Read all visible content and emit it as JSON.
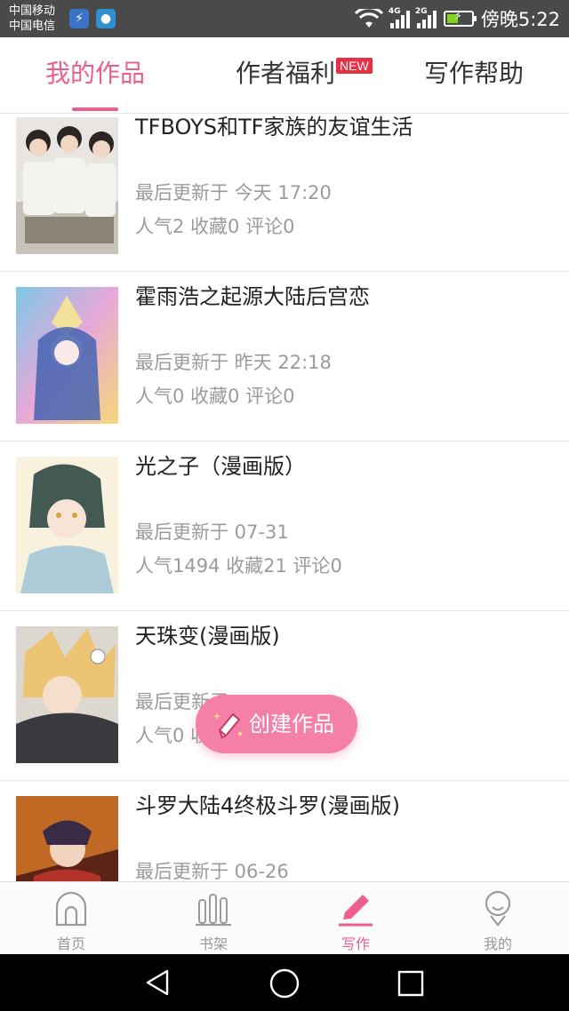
{
  "status_bar": {
    "carrier_1": "中国移动",
    "carrier_2": "中国电信",
    "net_1": "4G",
    "net_2": "2G",
    "time": "傍晚5:22"
  },
  "tabs": [
    {
      "label": "我的作品",
      "active": true
    },
    {
      "label": "作者福利",
      "active": false,
      "badge": "NEW"
    },
    {
      "label": "写作帮助",
      "active": false
    }
  ],
  "works": [
    {
      "title": "TFBOYS和TF家族的友谊生活",
      "updated": "最后更新于 今天 17:20",
      "stats": "人气2  收藏0  评论0"
    },
    {
      "title": "霍雨浩之起源大陆后宫恋",
      "updated": "最后更新于 昨天 22:18",
      "stats": "人气0  收藏0  评论0"
    },
    {
      "title": "光之子（漫画版）",
      "updated": "最后更新于 07-31",
      "stats": "人气1494  收藏21  评论0"
    },
    {
      "title": "天珠变(漫画版)",
      "updated": "最后更新于",
      "stats": "人气0  收藏0  评论0"
    },
    {
      "title": "斗罗大陆4终极斗罗(漫画版)",
      "updated": "最后更新于 06-26",
      "stats": ""
    }
  ],
  "fab": {
    "label": "创建作品"
  },
  "bottom_nav": [
    {
      "label": "首页",
      "icon": "home-icon",
      "active": false
    },
    {
      "label": "书架",
      "icon": "bookshelf-icon",
      "active": false
    },
    {
      "label": "写作",
      "icon": "pencil-icon",
      "active": true
    },
    {
      "label": "我的",
      "icon": "profile-icon",
      "active": false
    }
  ],
  "colors": {
    "accent": "#ec5f8a",
    "badge": "#e92f43",
    "fab": "#f480a8"
  }
}
